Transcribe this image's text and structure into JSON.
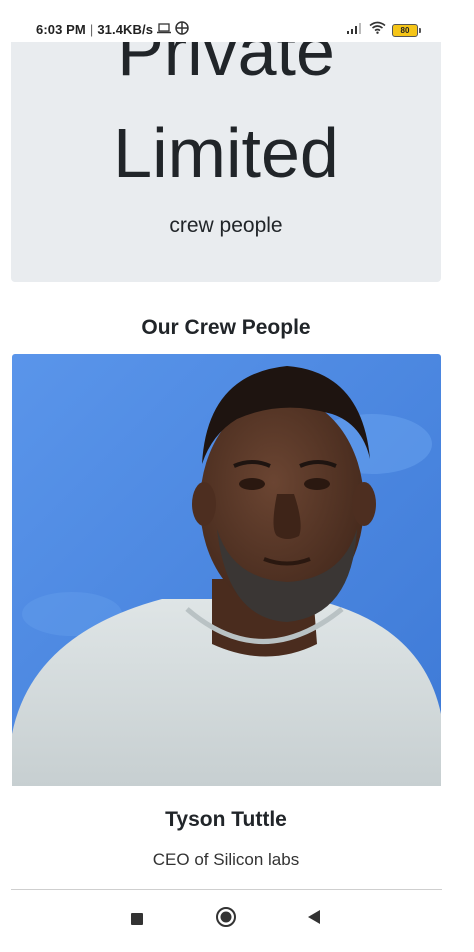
{
  "status_bar": {
    "time": "6:03 PM",
    "speed": "31.4KB/s",
    "battery": "80"
  },
  "hero": {
    "title_line1": "Private",
    "title_line2": "Limited",
    "subtitle": "crew people"
  },
  "section": {
    "heading": "Our Crew People"
  },
  "crew_card": {
    "name": "Tyson Tuttle",
    "role": "CEO of Silicon labs"
  },
  "nav": {
    "icons": [
      "recents-square-icon",
      "home-circle-icon",
      "back-triangle-icon"
    ]
  },
  "colors": {
    "hero_background": "#e9ecef",
    "photo_background": "#4a85e0",
    "battery_fill": "#f5c518"
  }
}
